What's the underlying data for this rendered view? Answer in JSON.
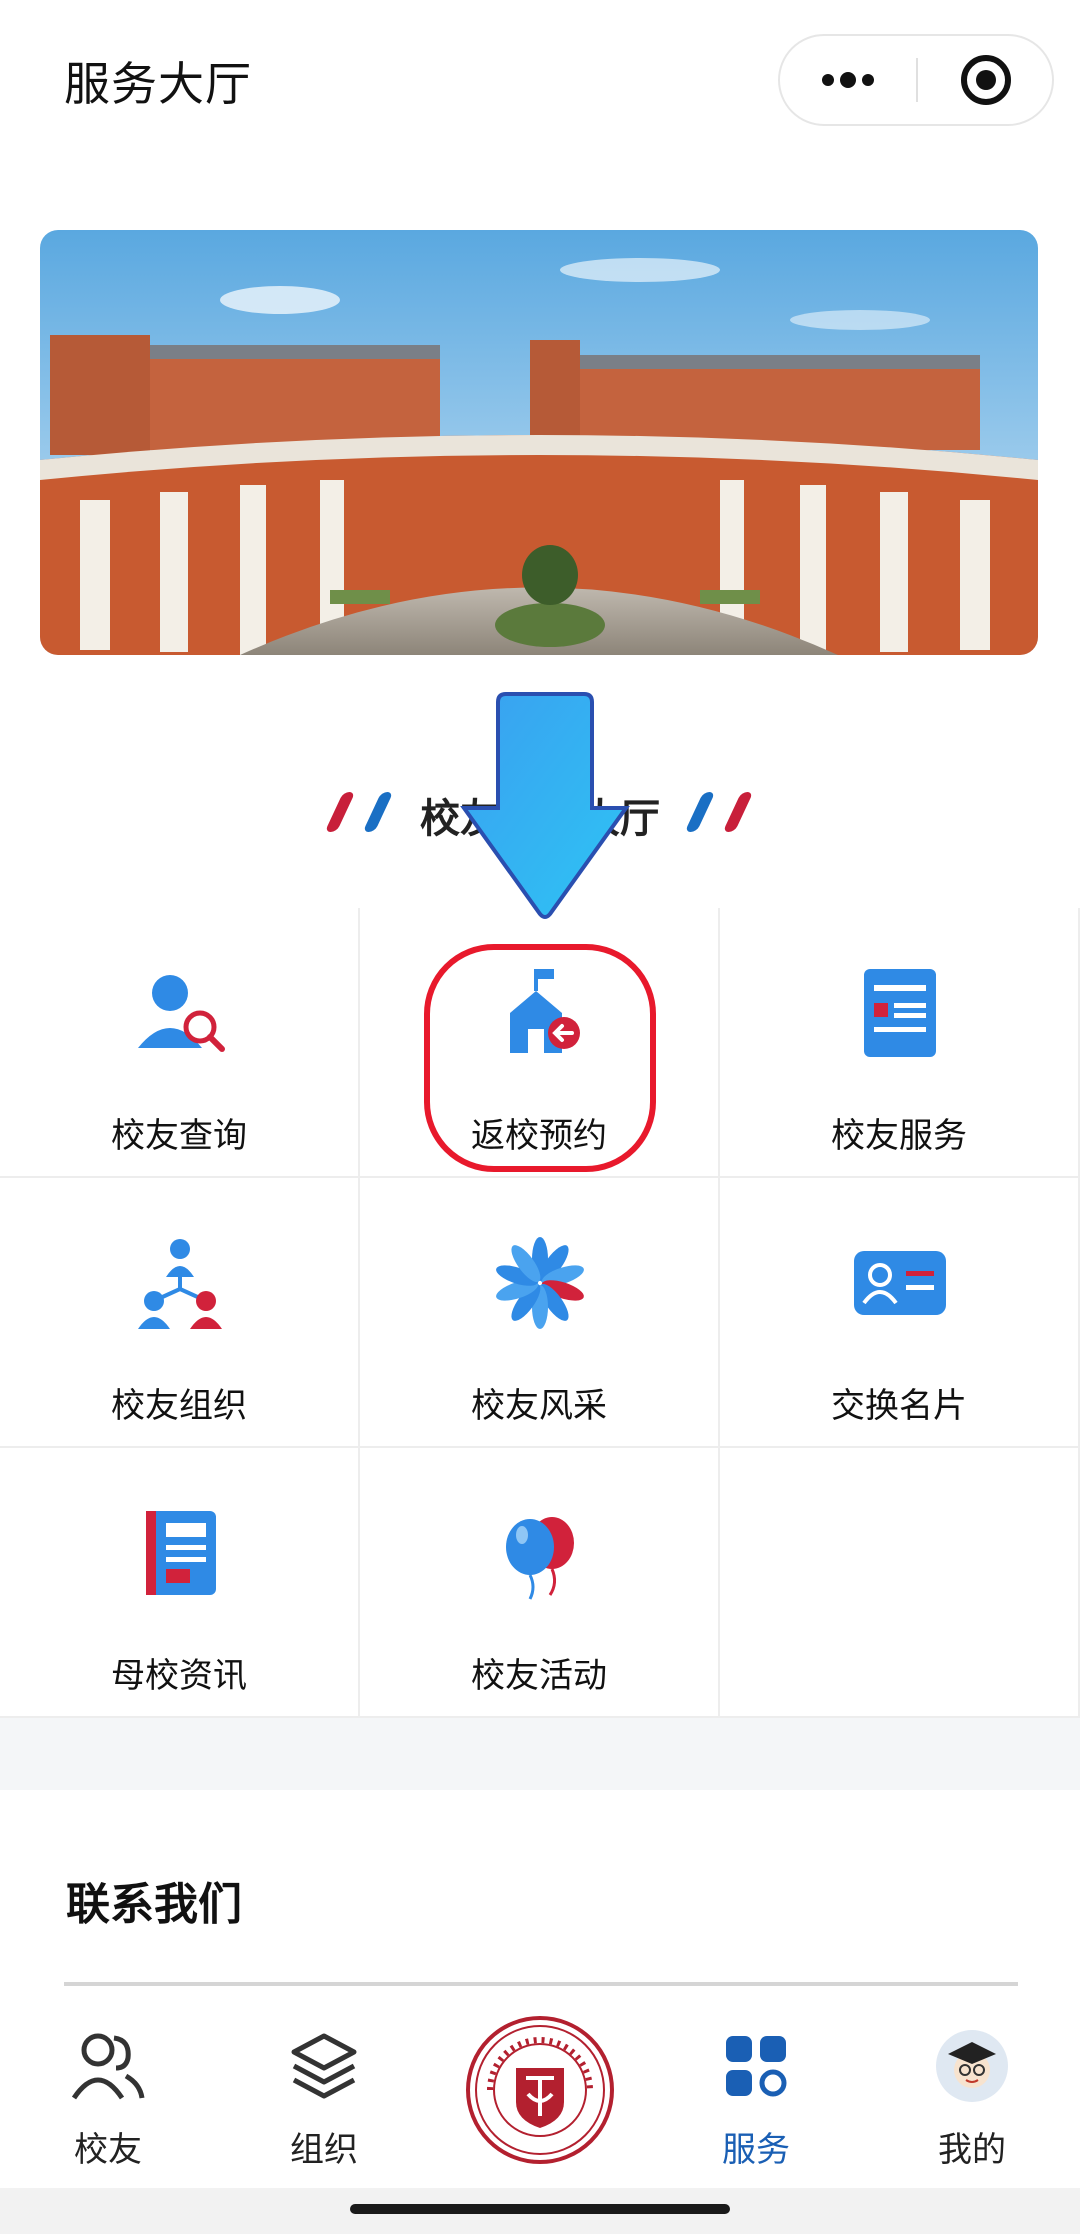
{
  "header": {
    "title": "服务大厅"
  },
  "section": {
    "title": "校友服务大厅"
  },
  "grid": {
    "items": [
      {
        "label": "校友查询",
        "icon": "alumni-search-icon"
      },
      {
        "label": "返校预约",
        "icon": "campus-return-icon"
      },
      {
        "label": "校友服务",
        "icon": "service-document-icon"
      },
      {
        "label": "校友组织",
        "icon": "organization-icon"
      },
      {
        "label": "校友风采",
        "icon": "pinwheel-icon"
      },
      {
        "label": "交换名片",
        "icon": "business-card-icon"
      },
      {
        "label": "母校资讯",
        "icon": "news-icon"
      },
      {
        "label": "校友活动",
        "icon": "balloons-icon"
      }
    ]
  },
  "contact": {
    "title": "联系我们"
  },
  "tabbar": {
    "items": [
      {
        "label": "校友",
        "icon": "people-icon",
        "active": false
      },
      {
        "label": "组织",
        "icon": "layers-icon",
        "active": false
      },
      {
        "label": "",
        "icon": "university-emblem-icon",
        "active": false
      },
      {
        "label": "服务",
        "icon": "grid-apps-icon",
        "active": true
      },
      {
        "label": "我的",
        "icon": "avatar-icon",
        "active": false
      }
    ]
  },
  "colors": {
    "accent": "#1a5fb4",
    "highlight": "#e8192c",
    "icon_blue": "#2f8ae5",
    "icon_red": "#d1223b"
  }
}
